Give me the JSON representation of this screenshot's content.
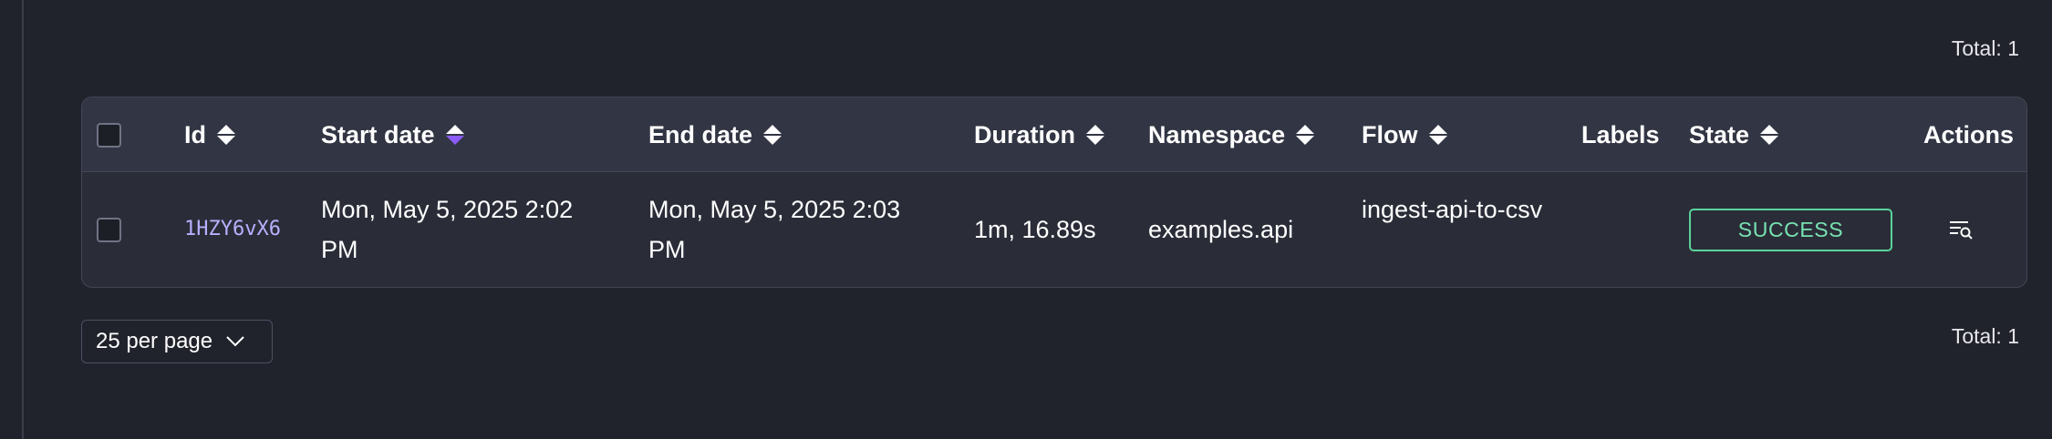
{
  "summary": {
    "total_top": "Total: 1",
    "total_bottom": "Total: 1"
  },
  "table": {
    "columns": {
      "id": "Id",
      "start_date": "Start date",
      "end_date": "End date",
      "duration": "Duration",
      "namespace": "Namespace",
      "flow": "Flow",
      "labels": "Labels",
      "state": "State",
      "actions": "Actions"
    },
    "rows": [
      {
        "id": "1HZY6vX6",
        "start_date": "Mon, May 5, 2025 2:02 PM",
        "end_date": "Mon, May 5, 2025 2:03 PM",
        "duration": "1m, 16.89s",
        "namespace": "examples.api",
        "flow": "ingest-api-to-csv",
        "labels": "",
        "state": "SUCCESS"
      }
    ]
  },
  "pagination": {
    "per_page": "25 per page"
  },
  "colors": {
    "accent": "#8b5cf6",
    "success": "#5bd39b",
    "id_link": "#b9b0ff"
  }
}
